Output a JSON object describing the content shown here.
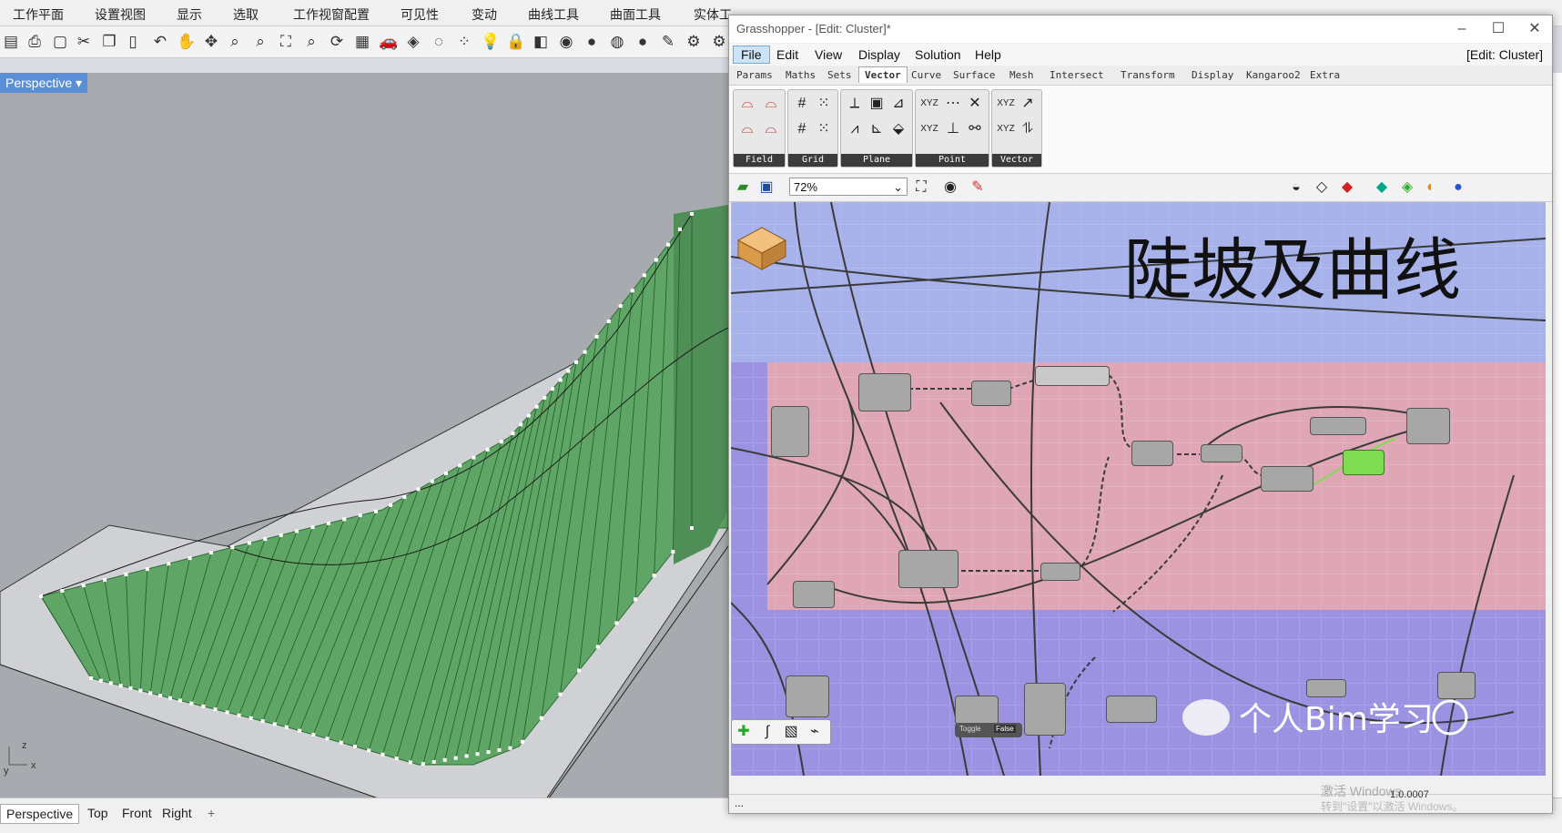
{
  "rhino": {
    "menu": [
      "工作平面",
      "设置视图",
      "显示",
      "选取",
      "工作视窗配置",
      "可见性",
      "变动",
      "曲线工具",
      "曲面工具",
      "实体工"
    ],
    "viewport_title": "Perspective",
    "viewport_tabs": [
      "Perspective",
      "Top",
      "Front",
      "Right"
    ],
    "add_tab": "+",
    "axis_x": "x",
    "axis_y": "y",
    "axis_z": "z"
  },
  "gh": {
    "title": "Grasshopper - [Edit: Cluster]*",
    "menu": [
      "File",
      "Edit",
      "View",
      "Display",
      "Solution",
      "Help"
    ],
    "menu_right": "[Edit: Cluster]",
    "tabs": [
      "Params",
      "Maths",
      "Sets",
      "Vector",
      "Curve",
      "Surface",
      "Mesh",
      "Intersect",
      "Transform",
      "Display",
      "Kangaroo2",
      "Extra"
    ],
    "selected_tab": "Vector",
    "ribbon_groups": [
      "Field",
      "Grid",
      "Plane",
      "Point",
      "Vector"
    ],
    "zoom": "72%",
    "canvas_title": "陡坡及曲线",
    "status": "...",
    "version": "1.0.0007",
    "toggle_label": "Toggle",
    "toggle_value": "False",
    "watermark": "个人Bim学习",
    "windows_watermark": "激活 Windows",
    "windows_watermark_sub": "转到\"设置\"以激活 Windows。"
  },
  "colors": {
    "canvas_blue": "#a7b2ea",
    "canvas_pink": "#dfa7b5",
    "canvas_purple": "#9c92e2",
    "surface_green": "#5fa566",
    "node_grey": "#a7a7a7",
    "active_blue": "#5a8ed6"
  }
}
